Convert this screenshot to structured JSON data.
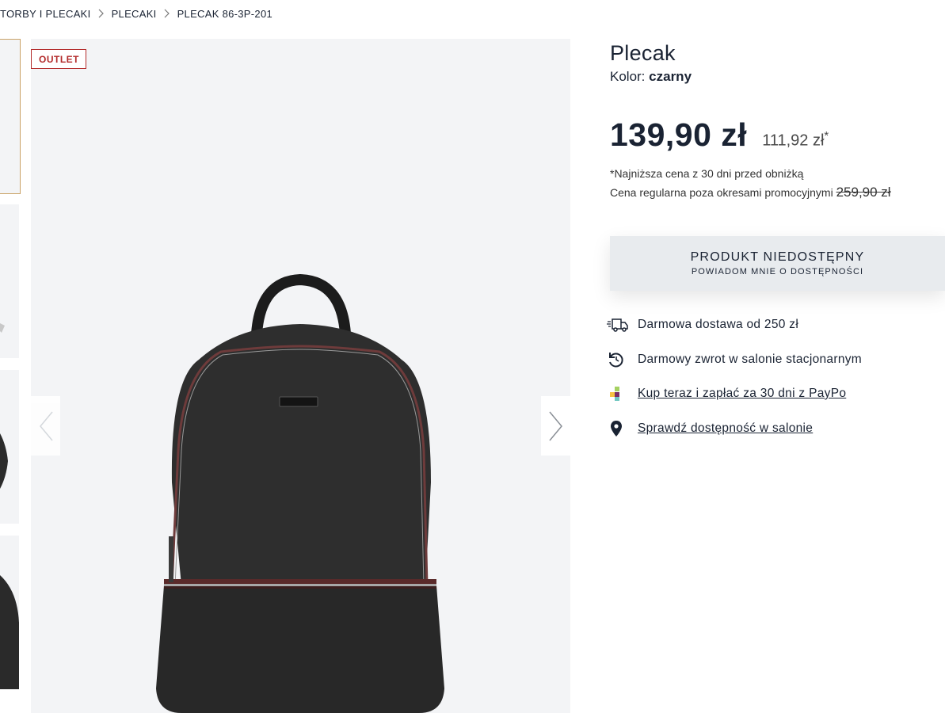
{
  "breadcrumb": {
    "items": [
      "TORBY I PLECAKI",
      "PLECAKI",
      "PLECAK 86-3P-201"
    ]
  },
  "gallery": {
    "badge": "OUTLET"
  },
  "product": {
    "name": "Plecak",
    "color_label": "Kolor:",
    "color_value": "czarny",
    "price": "139,90 zł",
    "lowest_price": "111,92 zł",
    "lowest_price_marker": "*",
    "lowest_note": "*Najniższa cena z 30 dni przed obniżką",
    "regular_note": "Cena regularna poza okresami promocyjnymi",
    "regular_price": "259,90 zł"
  },
  "availability": {
    "title": "PRODUKT NIEDOSTĘPNY",
    "subtitle": "POWIADOM MNIE O DOSTĘPNOŚCI"
  },
  "features": [
    {
      "icon": "delivery-truck-icon",
      "text": "Darmowa dostawa od 250 zł"
    },
    {
      "icon": "return-arrow-icon",
      "text": "Darmowy zwrot w salonie stacjonarnym"
    },
    {
      "icon": "paypo-logo-icon",
      "text": "Kup teraz i zapłać za 30 dni z PayPo"
    },
    {
      "icon": "location-pin-icon",
      "text": "Sprawdź dostępność w salonie"
    }
  ],
  "colors": {
    "text": "#1a2333",
    "badge": "#b32b2b",
    "button_bg": "#e8ebee",
    "gallery_bg": "#f3f4f6",
    "thumb_border": "#c9a266"
  }
}
